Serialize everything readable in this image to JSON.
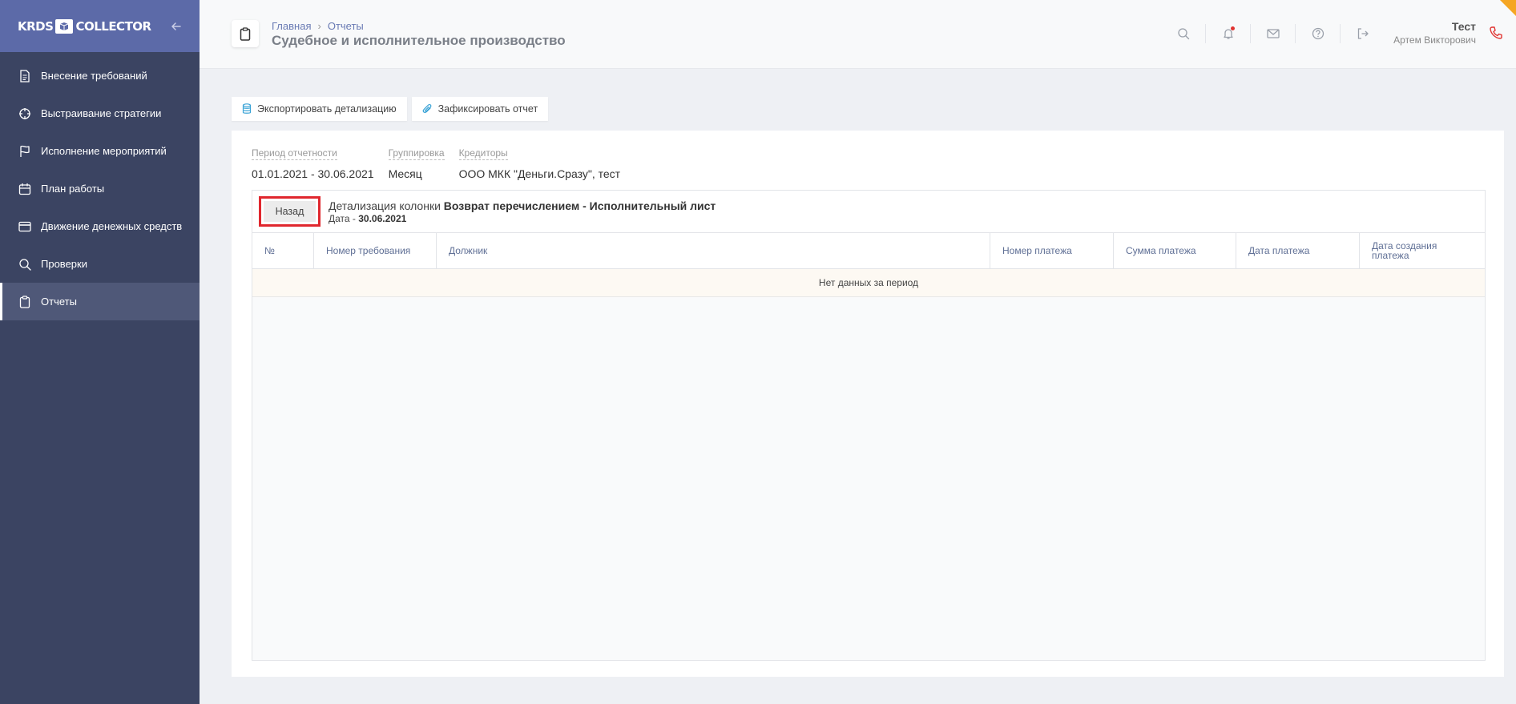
{
  "sidebar": {
    "logo_left": "KRDS",
    "logo_right": "COLLECTOR",
    "items": [
      {
        "label": "Внесение требований",
        "icon": "document-icon"
      },
      {
        "label": "Выстраивание стратегии",
        "icon": "crosshair-icon"
      },
      {
        "label": "Исполнение мероприятий",
        "icon": "flag-icon"
      },
      {
        "label": "План работы",
        "icon": "calendar-icon"
      },
      {
        "label": "Движение денежных средств",
        "icon": "credit-card-icon"
      },
      {
        "label": "Проверки",
        "icon": "search-icon"
      },
      {
        "label": "Отчеты",
        "icon": "clipboard-icon",
        "active": true
      }
    ]
  },
  "header": {
    "breadcrumbs": [
      "Главная",
      "Отчеты"
    ],
    "title": "Судебное и исполнительное производство",
    "icons": [
      "search-icon",
      "bell-icon",
      "mail-icon",
      "help-icon",
      "logout-icon"
    ],
    "user_name": "Тест",
    "user_sub": "Артем Викторович"
  },
  "toolbar": {
    "export_label": "Экспортировать детализацию",
    "fix_label": "Зафиксировать отчет"
  },
  "filters": {
    "period_label": "Период отчетности",
    "period_value": "01.01.2021 - 30.06.2021",
    "grouping_label": "Группировка",
    "grouping_value": "Месяц",
    "creditors_label": "Кредиторы",
    "creditors_value": "ООО МКК \"Деньги.Сразу\", тест"
  },
  "detail": {
    "back_label": "Назад",
    "prefix": "Детализация колонки",
    "column_name": "Возврат перечислением - Исполнительный лист",
    "date_prefix": "Дата -",
    "date_value": "30.06.2021"
  },
  "table": {
    "columns": [
      "№",
      "Номер требования",
      "Должник",
      "Номер платежа",
      "Сумма платежа",
      "Дата платежа",
      "Дата создания платежа"
    ],
    "empty_text": "Нет данных за период"
  },
  "colors": {
    "sidebar_bg": "#3b4462",
    "sidebar_head": "#5c6aa8",
    "accent_link": "#6a7bb4",
    "highlight_border": "#e0272e"
  }
}
